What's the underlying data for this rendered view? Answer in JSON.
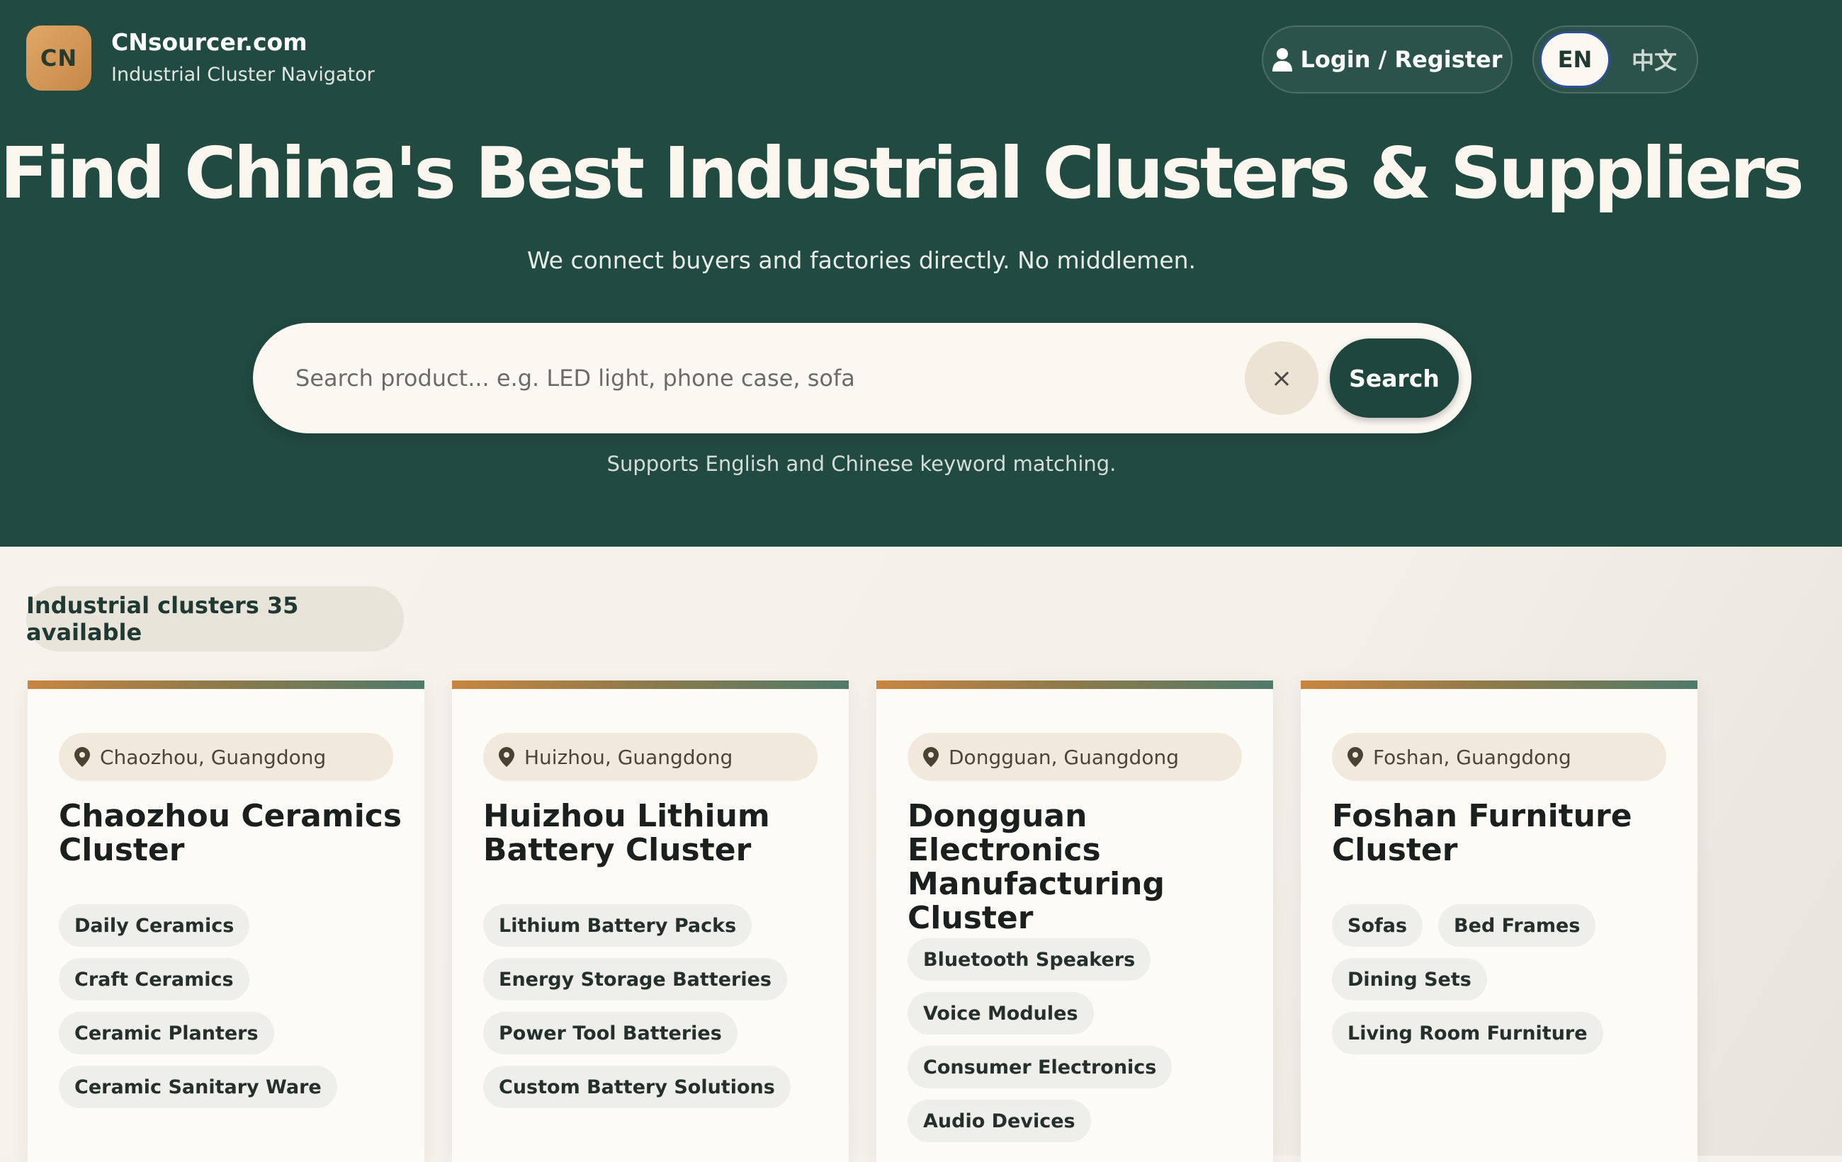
{
  "header": {
    "logo_text": "CN",
    "brand_name": "CNsourcer.com",
    "brand_tagline": "Industrial Cluster Navigator",
    "login_label": "Login / Register",
    "lang_en": "EN",
    "lang_zh": "中文"
  },
  "hero": {
    "title": "Find China's Best Industrial Clusters & Suppliers",
    "subtitle": "We connect buyers and factories directly. No middlemen.",
    "search_placeholder": "Search product... e.g. LED light, phone case, sofa",
    "search_value": "",
    "clear_label": "×",
    "search_button": "Search",
    "hint": "Supports English and Chinese keyword matching."
  },
  "clusters_summary": "Industrial clusters 35 available",
  "colors": {
    "hero_bg": "#214a40",
    "accent_orange": "#c98540",
    "accent_green": "#1f463d"
  },
  "cards": [
    {
      "location": "Chaozhou, Guangdong",
      "title": "Chaozhou Ceramics Cluster",
      "tags": [
        "Daily Ceramics",
        "Craft Ceramics",
        "Ceramic Planters",
        "Ceramic Sanitary Ware"
      ]
    },
    {
      "location": "Huizhou, Guangdong",
      "title": "Huizhou Lithium Battery Cluster",
      "tags": [
        "Lithium Battery Packs",
        "Energy Storage Batteries",
        "Power Tool Batteries",
        "Custom Battery Solutions"
      ]
    },
    {
      "location": "Dongguan, Guangdong",
      "title": "Dongguan Electronics Manufacturing Cluster",
      "tags": [
        "Bluetooth Speakers",
        "Voice Modules",
        "Consumer Electronics",
        "Audio Devices"
      ]
    },
    {
      "location": "Foshan, Guangdong",
      "title": "Foshan Furniture Cluster",
      "tags": [
        "Sofas",
        "Bed Frames",
        "Dining Sets",
        "Living Room Furniture"
      ]
    }
  ]
}
